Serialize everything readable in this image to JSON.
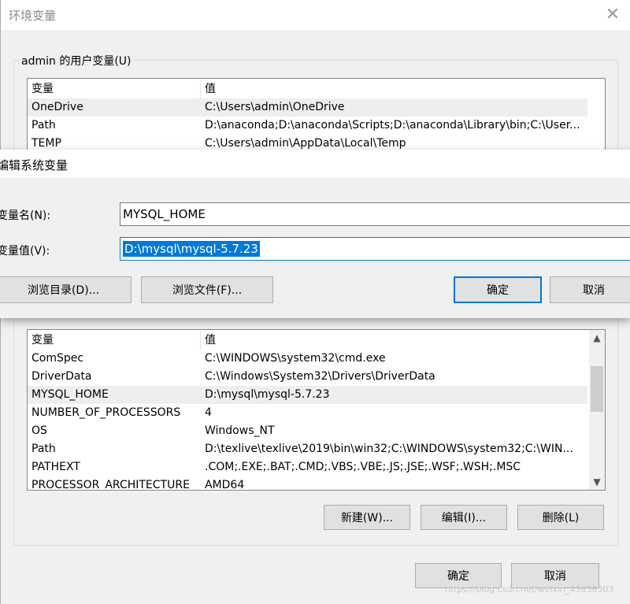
{
  "env_window": {
    "title": "环境变量",
    "close_glyph": "✕",
    "user_group_title": "admin 的用户变量(U)",
    "user_vars": {
      "headers": [
        "变量",
        "值"
      ],
      "rows": [
        {
          "name": "OneDrive",
          "value": "C:\\Users\\admin\\OneDrive"
        },
        {
          "name": "Path",
          "value": "D:\\anaconda;D:\\anaconda\\Scripts;D:\\anaconda\\Library\\bin;C:\\User..."
        },
        {
          "name": "TEMP",
          "value": "C:\\Users\\admin\\AppData\\Local\\Temp"
        }
      ]
    },
    "system_vars": {
      "headers": [
        "变量",
        "值"
      ],
      "rows": [
        {
          "name": "ComSpec",
          "value": "C:\\WINDOWS\\system32\\cmd.exe"
        },
        {
          "name": "DriverData",
          "value": "C:\\Windows\\System32\\Drivers\\DriverData"
        },
        {
          "name": "MYSQL_HOME",
          "value": "D:\\mysql\\mysql-5.7.23"
        },
        {
          "name": "NUMBER_OF_PROCESSORS",
          "value": "4"
        },
        {
          "name": "OS",
          "value": "Windows_NT"
        },
        {
          "name": "Path",
          "value": "D:\\texlive\\texlive\\2019\\bin\\win32;C:\\WINDOWS\\system32;C:\\WIN..."
        },
        {
          "name": "PATHEXT",
          "value": ".COM;.EXE;.BAT;.CMD;.VBS;.VBE;.JS;.JSE;.WSF;.WSH;.MSC"
        },
        {
          "name": "PROCESSOR_ARCHITECTURE",
          "value": "AMD64"
        }
      ]
    },
    "system_buttons": {
      "new": "新建(W)...",
      "edit": "编辑(I)...",
      "delete": "删除(L)"
    },
    "footer_buttons": {
      "ok": "确定",
      "cancel": "取消"
    },
    "scroll_up_glyph": "▲",
    "scroll_down_glyph": "▼"
  },
  "edit_dialog": {
    "title": "编辑系统变量",
    "name_label": "变量名(N):",
    "name_value": "MYSQL_HOME",
    "value_label": "变量值(V):",
    "value_value": "D:\\mysql\\mysql-5.7.23",
    "browse_dir": "浏览目录(D)...",
    "browse_file": "浏览文件(F)...",
    "ok": "确定",
    "cancel": "取消"
  },
  "watermark": "https://blog.csdn.net/weixin_43636303",
  "colors": {
    "accent": "#0078d7",
    "window_bg": "#f0f0f0",
    "selection_row": "#eeeeee"
  }
}
